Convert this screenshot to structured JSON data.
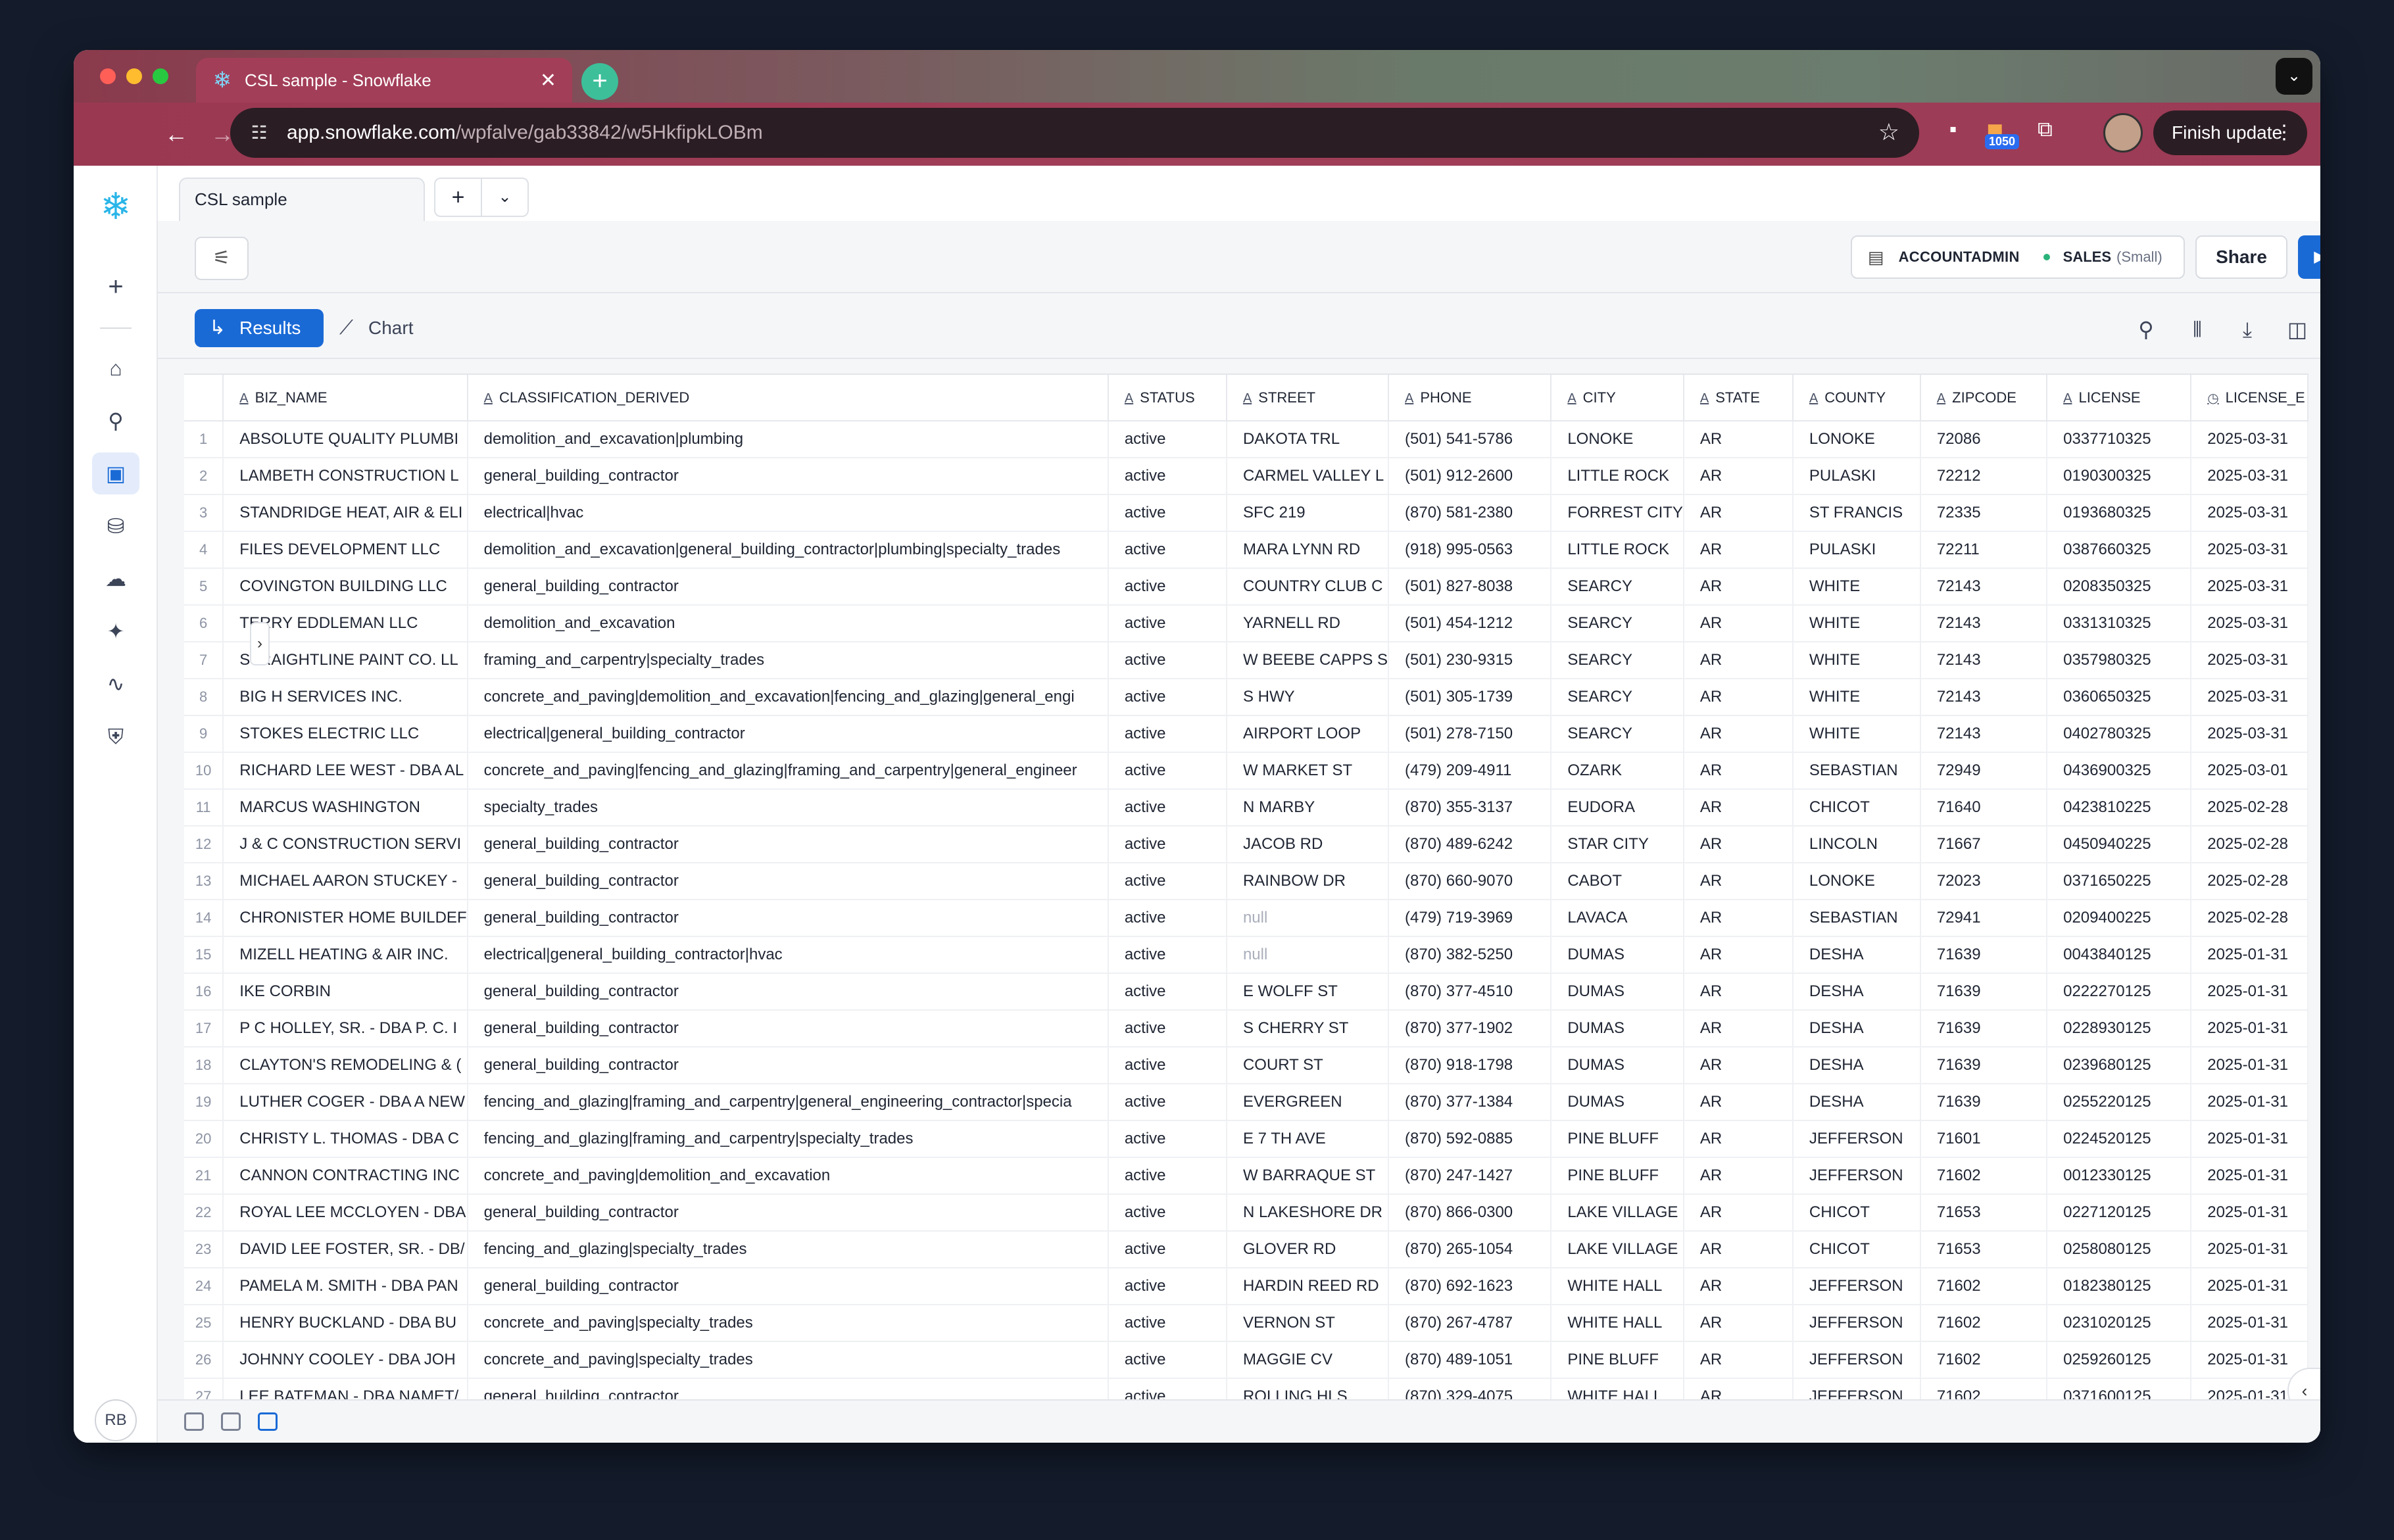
{
  "browser": {
    "tab_title": "CSL sample - Snowflake",
    "url_host": "app.snowflake.com",
    "url_path": "/wpfalve/gab33842/w5HkfipkLOBm",
    "extension_badge": "1050",
    "finish_update_label": "Finish update"
  },
  "sidebar": {
    "user_initials": "RB",
    "items": [
      "create-icon",
      "home-icon",
      "search-icon",
      "worksheets-icon",
      "data-icon",
      "cloud-icon",
      "ai-icon",
      "monitoring-icon",
      "admin-icon"
    ]
  },
  "worksheet": {
    "tab_label": "CSL sample",
    "role": "ACCOUNTADMIN",
    "warehouse": "SALES",
    "warehouse_size": "(Small)",
    "share_label": "Share"
  },
  "results": {
    "results_tab_label": "Results",
    "chart_tab_label": "Chart"
  },
  "table": {
    "columns": [
      {
        "name": "BIZ_NAME",
        "type": "A"
      },
      {
        "name": "CLASSIFICATION_DERIVED",
        "type": "A"
      },
      {
        "name": "STATUS",
        "type": "A"
      },
      {
        "name": "STREET",
        "type": "A"
      },
      {
        "name": "PHONE",
        "type": "A"
      },
      {
        "name": "CITY",
        "type": "A"
      },
      {
        "name": "STATE",
        "type": "A"
      },
      {
        "name": "COUNTY",
        "type": "A"
      },
      {
        "name": "ZIPCODE",
        "type": "A"
      },
      {
        "name": "LICENSE",
        "type": "A"
      },
      {
        "name": "LICENSE_E",
        "type": "◷"
      }
    ],
    "rows": [
      [
        "1",
        "ABSOLUTE QUALITY PLUMBI",
        "demolition_and_excavation|plumbing",
        "active",
        "DAKOTA TRL",
        "(501) 541-5786",
        "LONOKE",
        "AR",
        "LONOKE",
        "72086",
        "0337710325",
        "2025-03-31"
      ],
      [
        "2",
        "LAMBETH CONSTRUCTION L",
        "general_building_contractor",
        "active",
        "CARMEL VALLEY L",
        "(501) 912-2600",
        "LITTLE ROCK",
        "AR",
        "PULASKI",
        "72212",
        "0190300325",
        "2025-03-31"
      ],
      [
        "3",
        "STANDRIDGE HEAT, AIR & ELI",
        "electrical|hvac",
        "active",
        "SFC 219",
        "(870) 581-2380",
        "FORREST CITY",
        "AR",
        "ST FRANCIS",
        "72335",
        "0193680325",
        "2025-03-31"
      ],
      [
        "4",
        "FILES DEVELOPMENT LLC",
        "demolition_and_excavation|general_building_contractor|plumbing|specialty_trades",
        "active",
        "MARA LYNN RD",
        "(918) 995-0563",
        "LITTLE ROCK",
        "AR",
        "PULASKI",
        "72211",
        "0387660325",
        "2025-03-31"
      ],
      [
        "5",
        "COVINGTON BUILDING LLC",
        "general_building_contractor",
        "active",
        "COUNTRY CLUB C",
        "(501) 827-8038",
        "SEARCY",
        "AR",
        "WHITE",
        "72143",
        "0208350325",
        "2025-03-31"
      ],
      [
        "6",
        "TERRY EDDLEMAN LLC",
        "demolition_and_excavation",
        "active",
        "YARNELL RD",
        "(501) 454-1212",
        "SEARCY",
        "AR",
        "WHITE",
        "72143",
        "0331310325",
        "2025-03-31"
      ],
      [
        "7",
        "STRAIGHTLINE PAINT CO. LL",
        "framing_and_carpentry|specialty_trades",
        "active",
        "W BEEBE CAPPS S",
        "(501) 230-9315",
        "SEARCY",
        "AR",
        "WHITE",
        "72143",
        "0357980325",
        "2025-03-31"
      ],
      [
        "8",
        "BIG H SERVICES INC.",
        "concrete_and_paving|demolition_and_excavation|fencing_and_glazing|general_engi",
        "active",
        "S HWY",
        "(501) 305-1739",
        "SEARCY",
        "AR",
        "WHITE",
        "72143",
        "0360650325",
        "2025-03-31"
      ],
      [
        "9",
        "STOKES ELECTRIC LLC",
        "electrical|general_building_contractor",
        "active",
        "AIRPORT LOOP",
        "(501) 278-7150",
        "SEARCY",
        "AR",
        "WHITE",
        "72143",
        "0402780325",
        "2025-03-31"
      ],
      [
        "10",
        "RICHARD LEE WEST - DBA AL",
        "concrete_and_paving|fencing_and_glazing|framing_and_carpentry|general_engineer",
        "active",
        "W MARKET ST",
        "(479) 209-4911",
        "OZARK",
        "AR",
        "SEBASTIAN",
        "72949",
        "0436900325",
        "2025-03-01"
      ],
      [
        "11",
        "MARCUS WASHINGTON",
        "specialty_trades",
        "active",
        "N MARBY",
        "(870) 355-3137",
        "EUDORA",
        "AR",
        "CHICOT",
        "71640",
        "0423810225",
        "2025-02-28"
      ],
      [
        "12",
        "J & C CONSTRUCTION SERVI",
        "general_building_contractor",
        "active",
        "JACOB RD",
        "(870) 489-6242",
        "STAR CITY",
        "AR",
        "LINCOLN",
        "71667",
        "0450940225",
        "2025-02-28"
      ],
      [
        "13",
        "MICHAEL AARON STUCKEY -",
        "general_building_contractor",
        "active",
        "RAINBOW DR",
        "(870) 660-9070",
        "CABOT",
        "AR",
        "LONOKE",
        "72023",
        "0371650225",
        "2025-02-28"
      ],
      [
        "14",
        "CHRONISTER HOME BUILDEF",
        "general_building_contractor",
        "active",
        "null",
        "(479) 719-3969",
        "LAVACA",
        "AR",
        "SEBASTIAN",
        "72941",
        "0209400225",
        "2025-02-28"
      ],
      [
        "15",
        "MIZELL HEATING & AIR INC.",
        "electrical|general_building_contractor|hvac",
        "active",
        "null",
        "(870) 382-5250",
        "DUMAS",
        "AR",
        "DESHA",
        "71639",
        "0043840125",
        "2025-01-31"
      ],
      [
        "16",
        "IKE CORBIN",
        "general_building_contractor",
        "active",
        "E WOLFF ST",
        "(870) 377-4510",
        "DUMAS",
        "AR",
        "DESHA",
        "71639",
        "0222270125",
        "2025-01-31"
      ],
      [
        "17",
        "P C HOLLEY, SR. - DBA P. C. I",
        "general_building_contractor",
        "active",
        "S CHERRY ST",
        "(870) 377-1902",
        "DUMAS",
        "AR",
        "DESHA",
        "71639",
        "0228930125",
        "2025-01-31"
      ],
      [
        "18",
        "CLAYTON'S REMODELING & (",
        "general_building_contractor",
        "active",
        "COURT ST",
        "(870) 918-1798",
        "DUMAS",
        "AR",
        "DESHA",
        "71639",
        "0239680125",
        "2025-01-31"
      ],
      [
        "19",
        "LUTHER COGER - DBA A NEW",
        "fencing_and_glazing|framing_and_carpentry|general_engineering_contractor|specia",
        "active",
        "EVERGREEN",
        "(870) 377-1384",
        "DUMAS",
        "AR",
        "DESHA",
        "71639",
        "0255220125",
        "2025-01-31"
      ],
      [
        "20",
        "CHRISTY L. THOMAS - DBA C",
        "fencing_and_glazing|framing_and_carpentry|specialty_trades",
        "active",
        "E 7 TH AVE",
        "(870) 592-0885",
        "PINE BLUFF",
        "AR",
        "JEFFERSON",
        "71601",
        "0224520125",
        "2025-01-31"
      ],
      [
        "21",
        "CANNON CONTRACTING INC",
        "concrete_and_paving|demolition_and_excavation",
        "active",
        "W BARRAQUE ST",
        "(870) 247-1427",
        "PINE BLUFF",
        "AR",
        "JEFFERSON",
        "71602",
        "0012330125",
        "2025-01-31"
      ],
      [
        "22",
        "ROYAL LEE MCCLOYEN - DBA",
        "general_building_contractor",
        "active",
        "N LAKESHORE DR",
        "(870) 866-0300",
        "LAKE VILLAGE",
        "AR",
        "CHICOT",
        "71653",
        "0227120125",
        "2025-01-31"
      ],
      [
        "23",
        "DAVID LEE FOSTER, SR. - DB/",
        "fencing_and_glazing|specialty_trades",
        "active",
        "GLOVER RD",
        "(870) 265-1054",
        "LAKE VILLAGE",
        "AR",
        "CHICOT",
        "71653",
        "0258080125",
        "2025-01-31"
      ],
      [
        "24",
        "PAMELA M. SMITH - DBA PAN",
        "general_building_contractor",
        "active",
        "HARDIN REED RD",
        "(870) 692-1623",
        "WHITE HALL",
        "AR",
        "JEFFERSON",
        "71602",
        "0182380125",
        "2025-01-31"
      ],
      [
        "25",
        "HENRY BUCKLAND - DBA BU",
        "concrete_and_paving|specialty_trades",
        "active",
        "VERNON ST",
        "(870) 267-4787",
        "WHITE HALL",
        "AR",
        "JEFFERSON",
        "71602",
        "0231020125",
        "2025-01-31"
      ],
      [
        "26",
        "JOHNNY COOLEY - DBA JOH",
        "concrete_and_paving|specialty_trades",
        "active",
        "MAGGIE CV",
        "(870) 489-1051",
        "PINE BLUFF",
        "AR",
        "JEFFERSON",
        "71602",
        "0259260125",
        "2025-01-31"
      ],
      [
        "27",
        "LEE BATEMAN - DBA NAMET/",
        "general_building_contractor",
        "active",
        "ROLLING HLS",
        "(870) 329-4075",
        "WHITE HALL",
        "AR",
        "JEFFERSON",
        "71602",
        "0371600125",
        "2025-01-31"
      ]
    ]
  }
}
